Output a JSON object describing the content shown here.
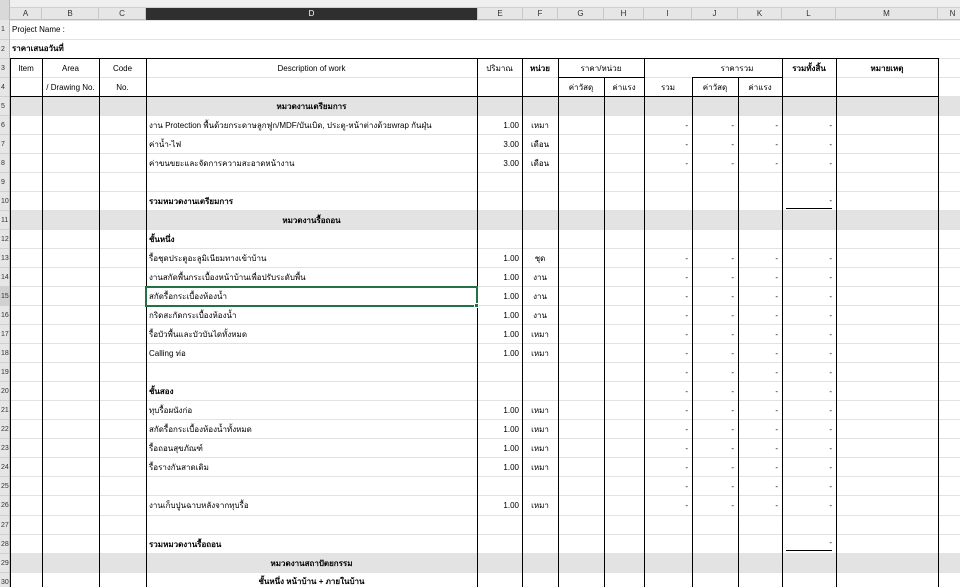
{
  "columns": [
    "A",
    "B",
    "C",
    "D",
    "E",
    "F",
    "G",
    "H",
    "I",
    "J",
    "K",
    "L",
    "M",
    "N"
  ],
  "selected_column": "D",
  "rows": [
    "1",
    "2",
    "3",
    "4",
    "5",
    "6",
    "7",
    "8",
    "9",
    "10",
    "11",
    "12",
    "13",
    "14",
    "15",
    "16",
    "17",
    "18",
    "19",
    "20",
    "21",
    "22",
    "23",
    "24",
    "25",
    "26",
    "27",
    "28",
    "29",
    "30"
  ],
  "selected_row": "15",
  "title_rows": {
    "project": "Project  Name :",
    "quote_date": "ราคาเสนอวันที่"
  },
  "headers": {
    "item": "Item",
    "area": "Area",
    "area_sub": "/ Drawing No.",
    "code": "Code",
    "code_sub": "No.",
    "description": "Description  of  work",
    "qty": "ปริมาณ",
    "unit": "หน่วย",
    "unit_price": "ราคา/หน่วย",
    "material": "ค่าวัสดุ",
    "labor": "ค่าแรง",
    "sum": "รวม",
    "total_price": "ราคารวม",
    "material2": "ค่าวัสดุ",
    "labor2": "ค่าแรง",
    "grand_total": "รวมทั้งสิ้น",
    "remarks": "หมายเหตุ"
  },
  "dash": "-",
  "sheet": {
    "sec1_title": "หมวดงานเตรียมการ",
    "r6_desc": "งาน Protection พื้นด้วยกระดาษลูกฟูก/MDF/บันเบิด, ประตู-หน้าต่างด้วยwrap กันฝุ่น",
    "r6_qty": "1.00",
    "r6_unit": "เหมา",
    "r7_desc": "ค่าน้ำ-ไฟ",
    "r7_qty": "3.00",
    "r7_unit": "เดือน",
    "r8_desc": "ค่าขนขยะและจัดการความสะอาดหน้างาน",
    "r8_qty": "3.00",
    "r8_unit": "เดือน",
    "sec1_total": "รวมหมวดงานเตรียมการ",
    "sec2_title": "หมวดงานรื้อถอน",
    "floor1": "ชั้นหนึ่ง",
    "r13_desc": "รื้อชุดประตูอะลูมิเนียมทางเข้าบ้าน",
    "r13_qty": "1.00",
    "r13_unit": "ชุด",
    "r14_desc": "งานสกัดพื้นกระเบื้องหน้าบ้านเพื่อปรับระดับพื้น",
    "r14_qty": "1.00",
    "r14_unit": "งาน",
    "r15_desc": "สกัดรื้อกระเบื้องห้องน้ำ",
    "r15_qty": "1.00",
    "r15_unit": "งาน",
    "r16_desc": "กริดสะกัดกระเบื้องห้องน้ำ",
    "r16_qty": "1.00",
    "r16_unit": "งาน",
    "r17_desc": "รื้อบัวพื้นและบัวบันไดทั้งหมด",
    "r17_qty": "1.00",
    "r17_unit": "เหมา",
    "r18_desc": "Calling ท่อ",
    "r18_qty": "1.00",
    "r18_unit": "เหมา",
    "floor2": "ชั้นสอง",
    "r21_desc": "ทุบรื้อผนังก่อ",
    "r21_qty": "1.00",
    "r21_unit": "เหมา",
    "r22_desc": "สกัดรื้อกระเบื้องห้องน้ำทั้งหมด",
    "r22_qty": "1.00",
    "r22_unit": "เหมา",
    "r23_desc": "รื้อถอนสุขภัณฑ์",
    "r23_qty": "1.00",
    "r23_unit": "เหมา",
    "r24_desc": "รื้อรางกันสาดเดิม",
    "r24_qty": "1.00",
    "r24_unit": "เหมา",
    "r26_desc": "งานเก็บปูนฉาบหลังจากทุบรื้อ",
    "r26_qty": "1.00",
    "r26_unit": "เหมา",
    "sec2_total": "รวมหมวดงานรื้อถอน",
    "sec3_title": "หมวดงานสถาปัตยกรรม",
    "sec3_sub": "ชั้นหนึ่ง หน้าบ้าน + ภายในบ้าน"
  },
  "colors": {
    "selection": "#217346",
    "section_band": "#e3e3e3",
    "header_bg": "#e6e6e6"
  }
}
